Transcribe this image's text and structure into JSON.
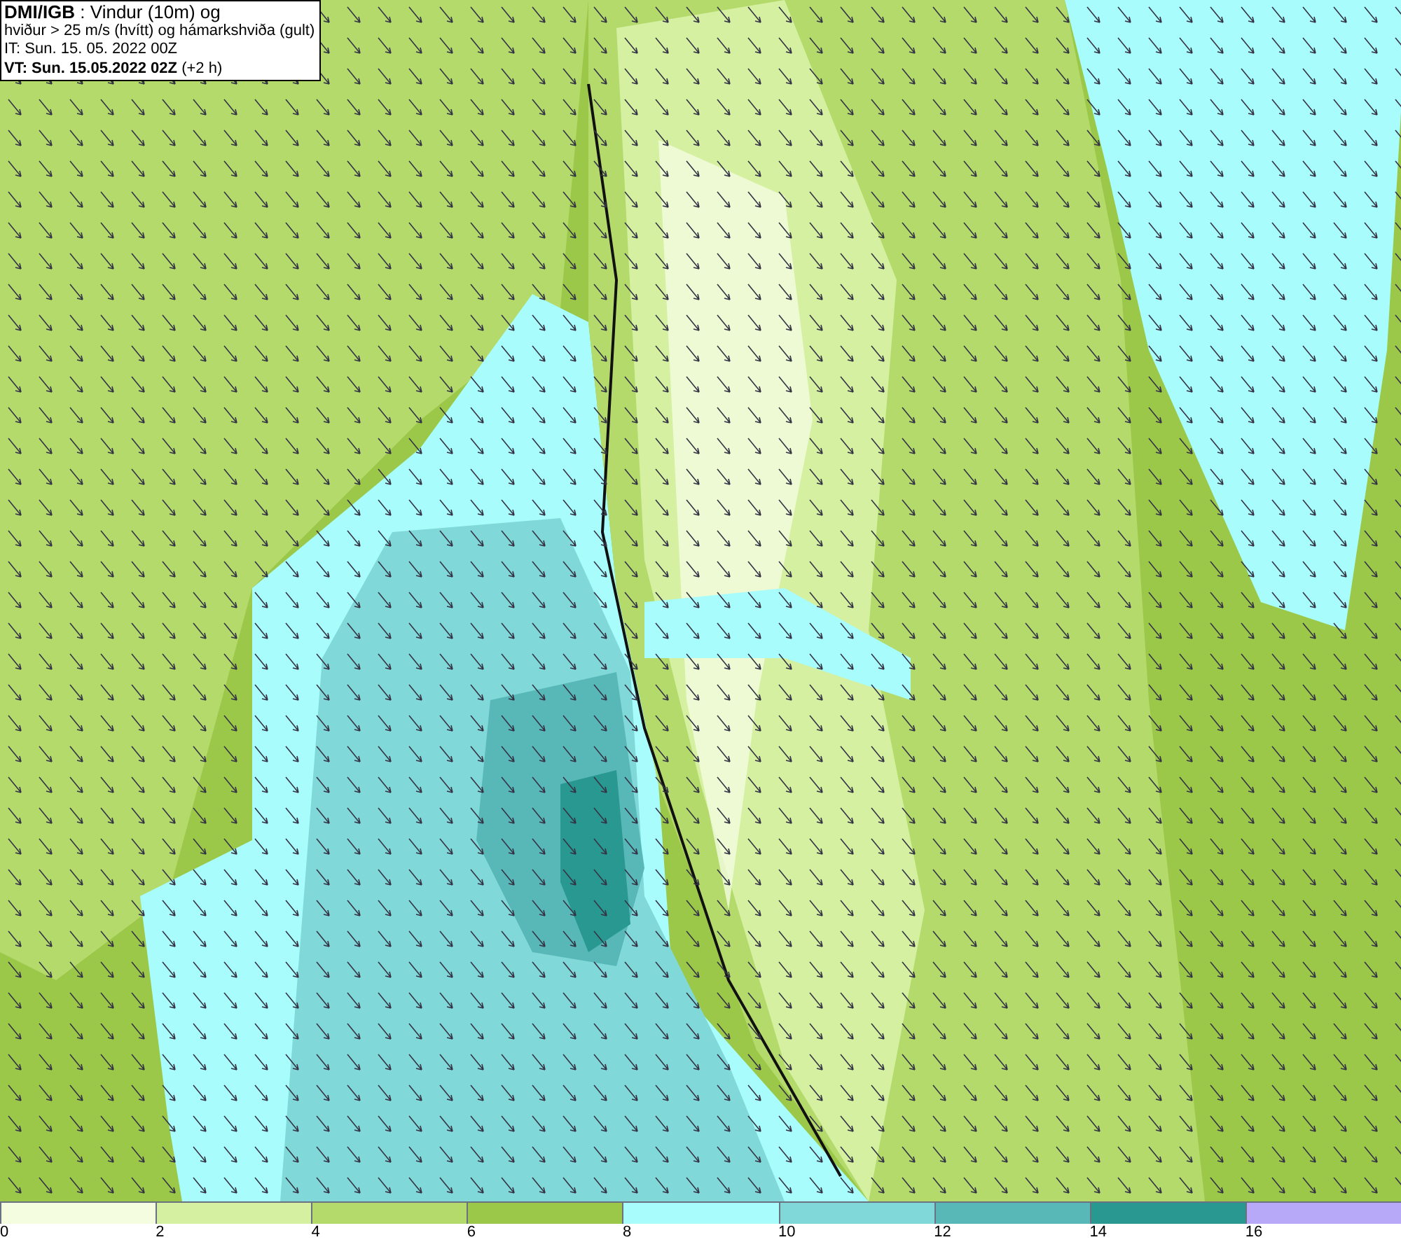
{
  "title_box": {
    "lines": [
      "**DMI/IGB** : Vindur (10m) og",
      "hviður > 25 m/s (hvítt) og hámarkshviða (gult)",
      "IT: Sun. 15. 05. 2022 00Z",
      "**VT: Sun. 15.05.2022 02Z** (+2 h)"
    ]
  },
  "legend": {
    "bins": [
      {
        "label": "0",
        "color": "#f4fde0"
      },
      {
        "label": "2",
        "color": "#d4f0a0"
      },
      {
        "label": "4",
        "color": "#b4da6c"
      },
      {
        "label": "6",
        "color": "#9cc84a"
      },
      {
        "label": "8",
        "color": "#a8fcfc"
      },
      {
        "label": "10",
        "color": "#80d8d8"
      },
      {
        "label": "12",
        "color": "#58b8b8"
      },
      {
        "label": "14",
        "color": "#289890"
      },
      {
        "label": "16",
        "color": "#b8a8f8"
      }
    ]
  }
}
